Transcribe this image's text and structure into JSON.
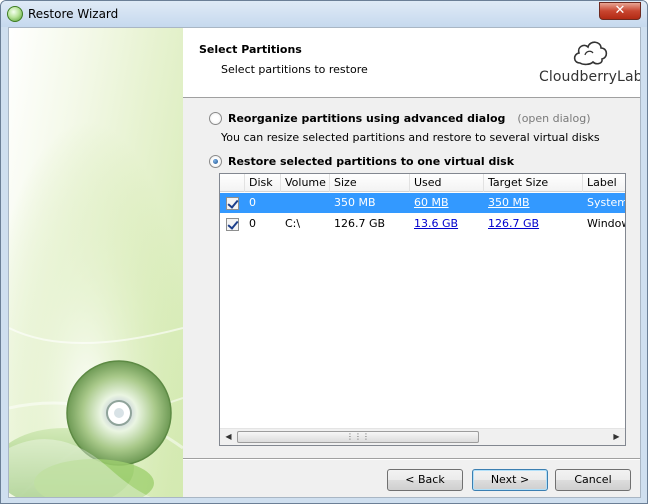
{
  "window": {
    "title": "Restore Wizard"
  },
  "header": {
    "title": "Select Partitions",
    "subtitle": "Select partitions to restore",
    "logo_text": "CloudberryLab"
  },
  "options": {
    "advanced": {
      "label": "Reorganize partitions using advanced dialog",
      "hint": "(open dialog)",
      "description": "You can resize selected partitions and restore to several virtual disks",
      "selected": false
    },
    "single": {
      "label": "Restore selected partitions to one virtual disk",
      "selected": true
    }
  },
  "partitions": {
    "columns": [
      "Disk",
      "Volume",
      "Size",
      "Used",
      "Target Size",
      "Label"
    ],
    "rows": [
      {
        "checked": true,
        "disk": "0",
        "volume": "",
        "size": "350 MB",
        "used": "60 MB",
        "target_size": "350 MB",
        "label": "System",
        "selected": true
      },
      {
        "checked": true,
        "disk": "0",
        "volume": "C:\\",
        "size": "126.7 GB",
        "used": "13.6 GB",
        "target_size": "126.7 GB",
        "label": "Window",
        "selected": false
      }
    ]
  },
  "buttons": {
    "back": "< Back",
    "next": "Next >",
    "cancel": "Cancel"
  },
  "icons": {
    "app": "cloudberry-app-icon",
    "close": "close-icon",
    "logo": "cloud-logo-icon",
    "scroll_left": "chevron-left-icon",
    "scroll_right": "chevron-right-icon"
  }
}
